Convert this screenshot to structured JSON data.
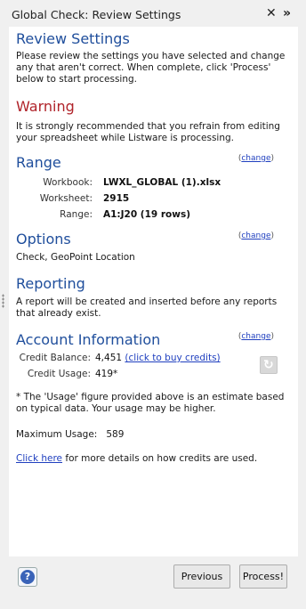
{
  "window": {
    "title": "Global Check: Review Settings",
    "close_glyph": "✕",
    "more_glyph": "»"
  },
  "review": {
    "title": "Review Settings",
    "text": "Please review the settings you have selected and change any that aren't correct. When complete, click 'Process' below to start processing."
  },
  "warning": {
    "title": "Warning",
    "text": "It is strongly recommended that you refrain from editing your spreadsheet while Listware is processing."
  },
  "range": {
    "title": "Range",
    "change_open": "(",
    "change_label": "change",
    "change_close": ")",
    "rows": [
      {
        "label": "Workbook:",
        "value": "LWXL_GLOBAL (1).xlsx"
      },
      {
        "label": "Worksheet:",
        "value": "2915"
      },
      {
        "label": "Range:",
        "value": "A1:J20 (19 rows)"
      }
    ]
  },
  "options": {
    "title": "Options",
    "change_open": "(",
    "change_label": "change",
    "change_close": ")",
    "text": "Check, GeoPoint Location"
  },
  "reporting": {
    "title": "Reporting",
    "text": "A report will be created and inserted before any reports that already exist."
  },
  "account": {
    "title": "Account Information",
    "change_open": "(",
    "change_label": "change",
    "change_close": ")",
    "balance_label": "Credit Balance:",
    "balance_value": "4,451",
    "buy_link": "(click to buy credits)",
    "usage_label": "Credit Usage:",
    "usage_value": "419*",
    "note": "* The 'Usage' figure provided above is an estimate based on typical data. Your usage may be higher.",
    "max_label": "Maximum Usage:",
    "max_value": "589",
    "details_link": "Click here",
    "details_text": " for more details on how credits are used."
  },
  "footer": {
    "help_glyph": "?",
    "previous_label": "Previous",
    "process_label": "Process!"
  },
  "icons": [
    "close-icon",
    "chevron-double-right-icon",
    "refresh-icon",
    "help-icon",
    "grip-icon"
  ],
  "colors": {
    "heading": "#1f4e9c",
    "warning": "#b0232a",
    "link": "#1f3fbf"
  }
}
